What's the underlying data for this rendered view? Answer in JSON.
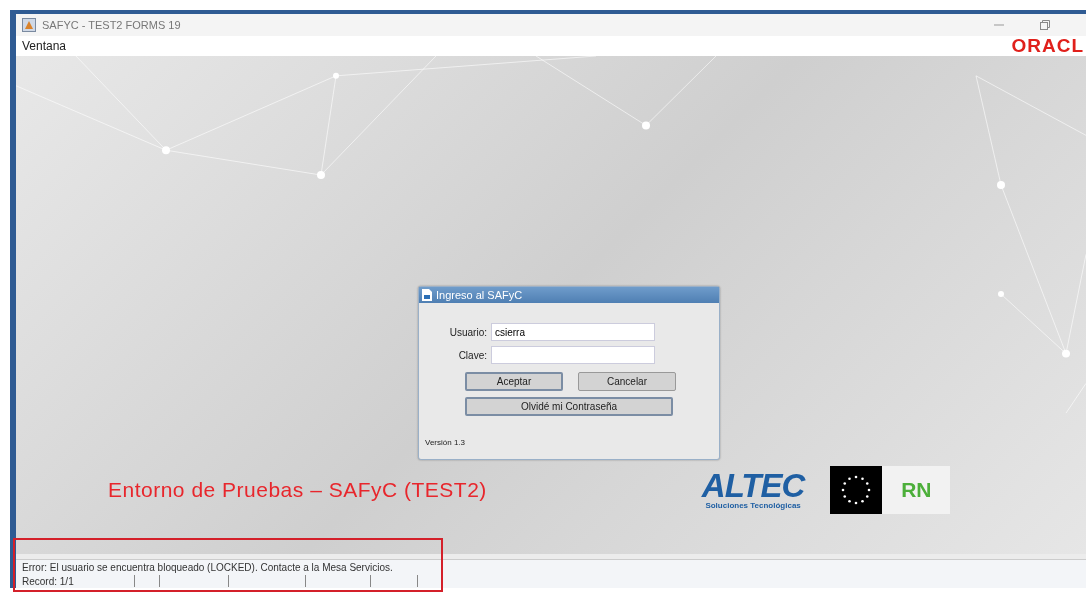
{
  "window": {
    "title": "SAFYC - TEST2 FORMS 19"
  },
  "menu": {
    "items": [
      "Ventana"
    ],
    "brand": "ORACL"
  },
  "dialog": {
    "title": "Ingreso al SAFyC",
    "fields": [
      {
        "label": "Usuario:",
        "value": "csierra"
      },
      {
        "label": "Clave:"
      }
    ],
    "buttons": [
      {
        "label": "Aceptar",
        "focused": true
      },
      {
        "label": "Cancelar",
        "focused": false
      }
    ],
    "wide_button": {
      "label": "Olvidé mi Contraseña"
    },
    "version": "Versión 1.3"
  },
  "banner": {
    "heading": "Entorno de Pruebas – SAFyC (TEST2)",
    "altec": "ALTEC",
    "altec_tagline": "Soluciones Tecnológicas",
    "rn": "RN"
  },
  "status_bar": {
    "message": "Error: El usuario se encuentra bloqueado (LOCKED). Contacte a la Mesa Servicios.",
    "record": "Record: 1/1"
  }
}
